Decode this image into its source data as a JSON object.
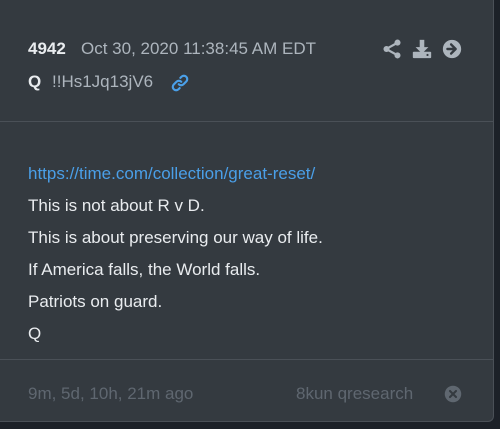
{
  "post": {
    "number": "4942",
    "timestamp": "Oct 30, 2020 11:38:45 AM EDT",
    "author": "Q",
    "tripcode": "!!Hs1Jq13jV6"
  },
  "header_actions": [
    {
      "icon": "share-icon"
    },
    {
      "icon": "download-icon"
    },
    {
      "icon": "arrow-right-circle-icon"
    }
  ],
  "body": {
    "link": "https://time.com/collection/great-reset/",
    "lines": [
      "This is not about R v D.",
      "This is about preserving our way of life.",
      "If America falls, the World falls.",
      "Patriots on guard.",
      "Q"
    ]
  },
  "footer": {
    "age": "9m, 5d, 10h, 21m ago",
    "source": "8kun qresearch"
  },
  "colors": {
    "background": "#1c2128",
    "card": "#343a40",
    "link": "#4a9fe8",
    "icon": "#adb5bd",
    "muted": "#5f6770"
  }
}
